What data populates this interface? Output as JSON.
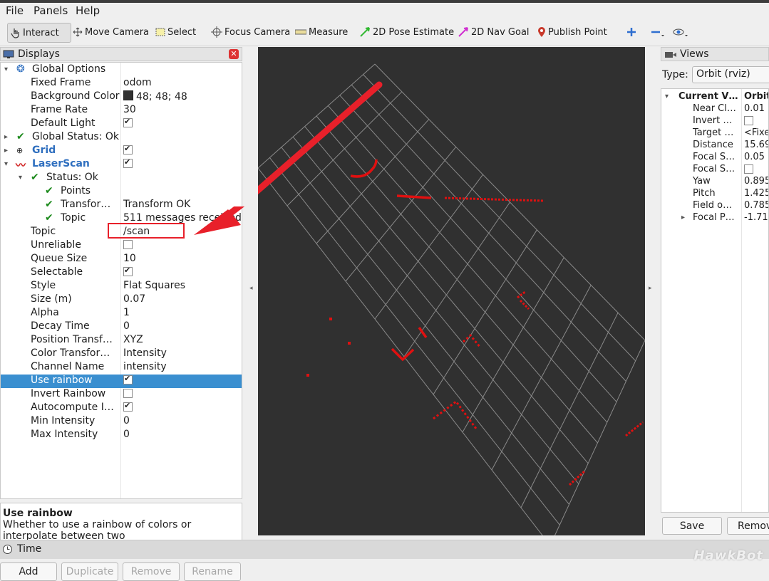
{
  "menu": {
    "file": "File",
    "panels": "Panels",
    "help": "Help"
  },
  "toolbar": {
    "interact": "Interact",
    "move_camera": "Move Camera",
    "select": "Select",
    "focus_camera": "Focus Camera",
    "measure": "Measure",
    "pose_estimate": "2D Pose Estimate",
    "nav_goal": "2D Nav Goal",
    "publish_point": "Publish Point"
  },
  "displays": {
    "title": "Displays",
    "rows": [
      {
        "label": "Global Options",
        "value": ""
      },
      {
        "label": "Fixed Frame",
        "value": "odom"
      },
      {
        "label": "Background Color",
        "value": "48; 48; 48"
      },
      {
        "label": "Frame Rate",
        "value": "30"
      },
      {
        "label": "Default Light",
        "value": ""
      },
      {
        "label": "Global Status: Ok",
        "value": ""
      },
      {
        "label": "Grid",
        "value": ""
      },
      {
        "label": "LaserScan",
        "value": ""
      },
      {
        "label": "Status: Ok",
        "value": ""
      },
      {
        "label": "Points",
        "value": ""
      },
      {
        "label": "Transfor…",
        "value": "Transform OK"
      },
      {
        "label": "Topic",
        "value": "511 messages received"
      },
      {
        "label": "Topic",
        "value": "/scan"
      },
      {
        "label": "Unreliable",
        "value": ""
      },
      {
        "label": "Queue Size",
        "value": "10"
      },
      {
        "label": "Selectable",
        "value": ""
      },
      {
        "label": "Style",
        "value": "Flat Squares"
      },
      {
        "label": "Size (m)",
        "value": "0.07"
      },
      {
        "label": "Alpha",
        "value": "1"
      },
      {
        "label": "Decay Time",
        "value": "0"
      },
      {
        "label": "Position Transf…",
        "value": "XYZ"
      },
      {
        "label": "Color Transfor…",
        "value": "Intensity"
      },
      {
        "label": "Channel Name",
        "value": "intensity"
      },
      {
        "label": "Use rainbow",
        "value": ""
      },
      {
        "label": "Invert Rainbow",
        "value": ""
      },
      {
        "label": "Autocompute I…",
        "value": ""
      },
      {
        "label": "Min Intensity",
        "value": "0"
      },
      {
        "label": "Max Intensity",
        "value": "0"
      }
    ],
    "desc_title": "Use rainbow",
    "desc_text": "Whether to use a rainbow of colors or interpolate between two",
    "buttons": {
      "add": "Add",
      "duplicate": "Duplicate",
      "remove": "Remove",
      "rename": "Rename"
    }
  },
  "views": {
    "title": "Views",
    "type_label": "Type:",
    "type_value": "Orbit (rviz)",
    "rows": [
      {
        "k": "Current V…",
        "v": "Orbit"
      },
      {
        "k": "Near Cl…",
        "v": "0.01"
      },
      {
        "k": "Invert …",
        "v": ""
      },
      {
        "k": "Target …",
        "v": "<Fixe"
      },
      {
        "k": "Distance",
        "v": "15.69"
      },
      {
        "k": "Focal S…",
        "v": "0.05"
      },
      {
        "k": "Focal S…",
        "v": ""
      },
      {
        "k": "Yaw",
        "v": "0.895"
      },
      {
        "k": "Pitch",
        "v": "1.425"
      },
      {
        "k": "Field o…",
        "v": "0.785"
      },
      {
        "k": "Focal P…",
        "v": "-1.715"
      }
    ],
    "save": "Save",
    "remove": "Remov"
  },
  "time": {
    "title": "Time"
  },
  "watermark": "HawkBot",
  "colors": {
    "selection": "#3a8fd0",
    "scan_points": "#e01010",
    "annotation": "#e8202a",
    "viewport_bg": "#303030"
  }
}
